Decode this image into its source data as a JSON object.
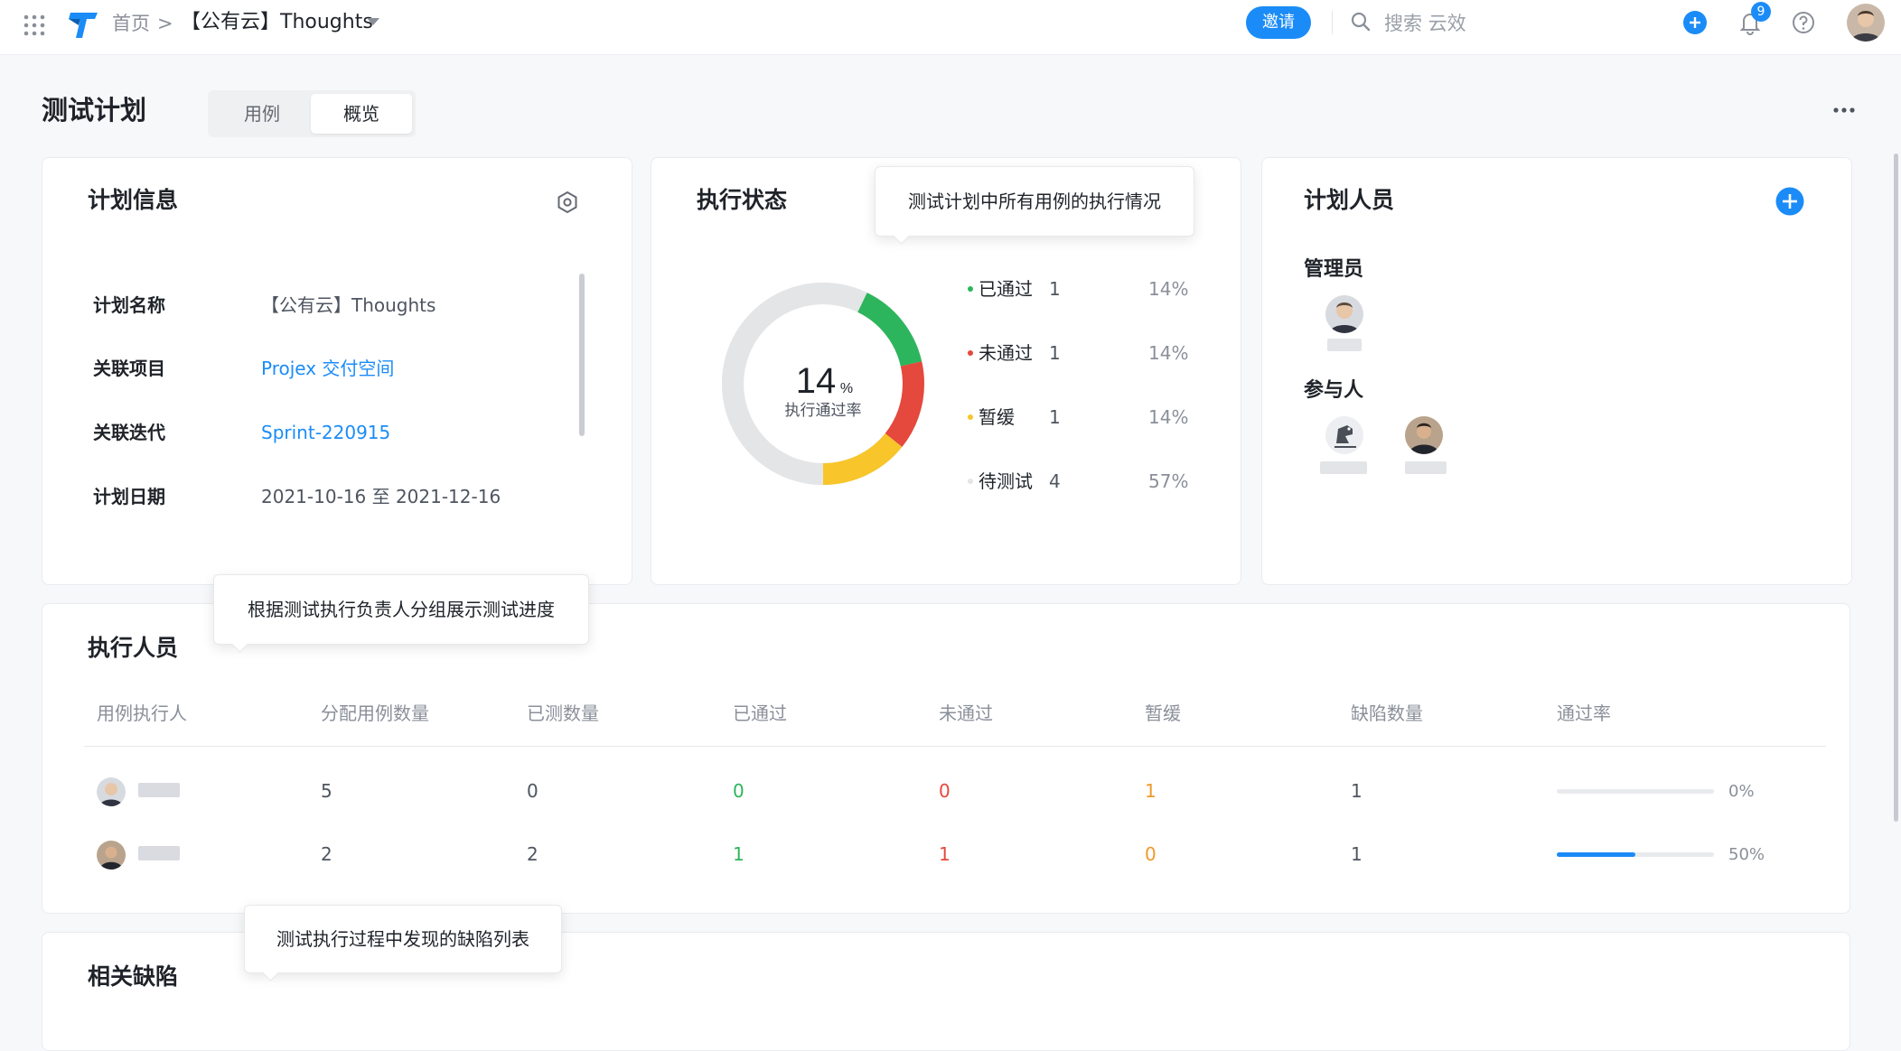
{
  "topbar": {
    "breadcrumb_home": "首页",
    "breadcrumb_sep": ">",
    "project_name": "【公有云】Thoughts",
    "invite_label": "邀请",
    "search_placeholder": "搜索 云效",
    "notification_count": "9",
    "accent_color": "#1b8cf7"
  },
  "page": {
    "title": "测试计划",
    "tabs": [
      {
        "label": "用例",
        "active": false
      },
      {
        "label": "概览",
        "active": true
      }
    ]
  },
  "plan_info": {
    "title": "计划信息",
    "rows": [
      {
        "label": "计划名称",
        "value": "【公有云】Thoughts"
      },
      {
        "label": "关联项目",
        "value": "Projex 交付空间"
      },
      {
        "label": "关联迭代",
        "value": "Sprint-220915"
      },
      {
        "label": "计划日期",
        "value": "2021-10-16 至 2021-12-16"
      }
    ]
  },
  "exec_status": {
    "title": "执行状态",
    "tooltip": "测试计划中所有用例的执行情况",
    "center_value": "14",
    "center_unit": "%",
    "center_label": "执行通过率",
    "legend": [
      {
        "label": "已通过",
        "count": "1",
        "pct": "14%",
        "color": "#2db55d"
      },
      {
        "label": "未通过",
        "count": "1",
        "pct": "14%",
        "color": "#e5483c"
      },
      {
        "label": "暂缓",
        "count": "1",
        "pct": "14%",
        "color": "#f8c52a"
      },
      {
        "label": "待测试",
        "count": "4",
        "pct": "57%",
        "color": "#e4e5e7"
      }
    ]
  },
  "members": {
    "title": "计划人员",
    "admin_label": "管理员",
    "participant_label": "参与人"
  },
  "executors": {
    "title": "执行人员",
    "tooltip": "根据测试执行负责人分组展示测试进度",
    "columns": [
      "用例执行人",
      "分配用例数量",
      "已测数量",
      "已通过",
      "未通过",
      "暂缓",
      "缺陷数量",
      "通过率"
    ],
    "rows": [
      {
        "assigned": "5",
        "tested": "0",
        "passed": "0",
        "failed": "0",
        "deferred": "1",
        "defects": "1",
        "pass_rate": 0,
        "pass_rate_label": "0%"
      },
      {
        "assigned": "2",
        "tested": "2",
        "passed": "1",
        "failed": "1",
        "deferred": "0",
        "defects": "1",
        "pass_rate": 0.5,
        "pass_rate_label": "50%"
      }
    ]
  },
  "defects": {
    "title": "相关缺陷",
    "tooltip": "测试执行过程中发现的缺陷列表"
  }
}
